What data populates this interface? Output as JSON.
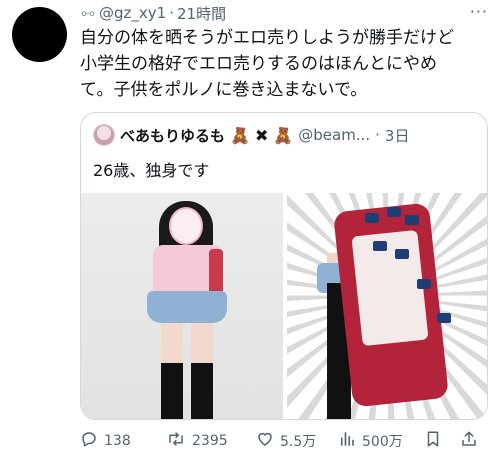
{
  "post": {
    "handle": "@gz_xy1",
    "separator": "·",
    "time": "21時間",
    "text_lines": [
      "自分の体を晒そうがエロ売りしようが勝手だけど",
      "小学生の格好でエロ売りするのはほんとにやめ",
      "て。子供をポルノに巻き込まないで。"
    ]
  },
  "quote": {
    "name": "べあもりゆるも",
    "cross": "✖",
    "handle": "@beam...",
    "separator": "·",
    "time": "3日",
    "text": "26歳、独身です"
  },
  "actions": {
    "replies": "138",
    "retweets": "2395",
    "likes": "5.5万",
    "views": "500万"
  },
  "icons": {
    "link": "link-icon",
    "more": "more-icon",
    "bear": "teddy-bear-icon",
    "reply": "reply-icon",
    "retweet": "retweet-icon",
    "like": "heart-icon",
    "views": "views-icon",
    "bookmark": "bookmark-icon",
    "share": "share-icon"
  }
}
